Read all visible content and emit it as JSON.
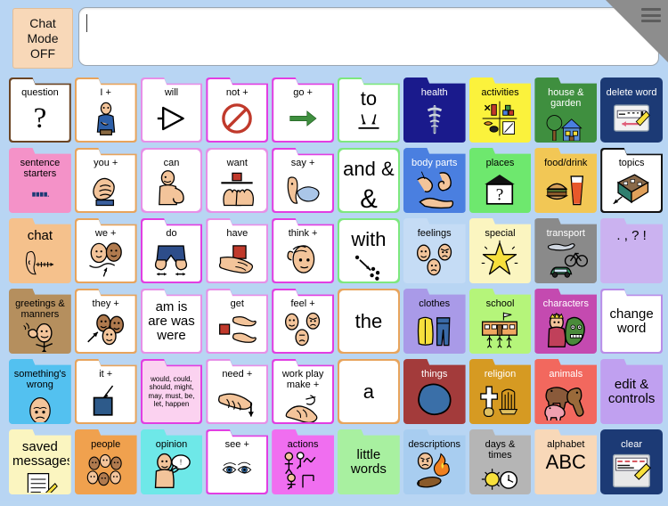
{
  "app": {
    "title": "AAC Communication Board",
    "background_color": "#b8d5f3"
  },
  "topbar": {
    "chat_mode_label": "Chat\nMode\nOFF",
    "chat_mode_line1": "Chat",
    "chat_mode_line2": "Mode",
    "chat_mode_line3": "OFF",
    "chat_mode_color": "#f8d8b8",
    "message_value": "",
    "message_placeholder": "",
    "menu_icon": "hamburger-menu-icon",
    "corner_color": "#8d8d8d"
  },
  "grid": {
    "columns": 10,
    "rows": 6,
    "buttons": [
      {
        "r": 1,
        "c": 1,
        "label": "question",
        "sub": "?",
        "bg": "#ffffff",
        "border": "#6b4423",
        "shape": "folder",
        "icon": "question-mark",
        "label_size": "small"
      },
      {
        "r": 1,
        "c": 2,
        "label": "I +",
        "bg": "#ffffff",
        "border": "#e8a45c",
        "shape": "folder",
        "icon": "person-pointing-self",
        "label_size": "small"
      },
      {
        "r": 1,
        "c": 3,
        "label": "will",
        "bg": "#ffffff",
        "border": "#e78fe7",
        "shape": "folder",
        "icon": "triangle-arrow-right",
        "label_size": "small"
      },
      {
        "r": 1,
        "c": 4,
        "label": "not +",
        "bg": "#ffffff",
        "border": "#e23ee2",
        "shape": "folder",
        "icon": "prohibition-sign",
        "label_size": "small"
      },
      {
        "r": 1,
        "c": 5,
        "label": "go +",
        "bg": "#ffffff",
        "border": "#e23ee2",
        "shape": "folder",
        "icon": "green-arrow-right",
        "label_size": "small"
      },
      {
        "r": 1,
        "c": 6,
        "label": "to",
        "bg": "#ffffff",
        "border": "#7ee87e",
        "shape": "folder",
        "icon": "two-arrows-down-line",
        "label_size": "big"
      },
      {
        "r": 1,
        "c": 7,
        "label": "health",
        "bg": "#1a1a8c",
        "border": "#1a1a8c",
        "shape": "folder",
        "icon": "caduceus",
        "label_color": "#ffffff",
        "label_size": "small"
      },
      {
        "r": 1,
        "c": 8,
        "label": "activities",
        "bg": "#fbf23c",
        "border": "#fbf23c",
        "shape": "folder",
        "icon": "craft-supplies",
        "label_size": "small"
      },
      {
        "r": 1,
        "c": 9,
        "label": "house & garden",
        "bg": "#3f8f3f",
        "border": "#3f8f3f",
        "shape": "folder",
        "icon": "house-and-tree",
        "label_color": "#ffffff",
        "label_size": "small"
      },
      {
        "r": 1,
        "c": 10,
        "label": "delete word",
        "bg": "#1c3a75",
        "border": "#1c3a75",
        "shape": "plain",
        "icon": "delete-word-eraser",
        "label_color": "#ffffff",
        "label_size": "small"
      },
      {
        "r": 2,
        "c": 1,
        "label": "sentence starters",
        "bg": "#f492c8",
        "border": "#f492c8",
        "shape": "folder",
        "icon": "sentence-blocks",
        "label_size": "small"
      },
      {
        "r": 2,
        "c": 2,
        "label": "you +",
        "bg": "#ffffff",
        "border": "#e8a45c",
        "shape": "folder",
        "icon": "pointing-hand",
        "label_size": "small"
      },
      {
        "r": 2,
        "c": 3,
        "label": "can",
        "bg": "#ffffff",
        "border": "#e78fe7",
        "shape": "plain",
        "icon": "flexing-arm",
        "label_size": "small"
      },
      {
        "r": 2,
        "c": 4,
        "label": "want",
        "bg": "#ffffff",
        "border": "#e78fe7",
        "shape": "plain",
        "icon": "hands-reaching-block",
        "label_size": "small"
      },
      {
        "r": 2,
        "c": 5,
        "label": "say +",
        "bg": "#ffffff",
        "border": "#e23ee2",
        "shape": "folder",
        "icon": "speech-bubble-face",
        "label_size": "small"
      },
      {
        "r": 2,
        "c": 6,
        "label": "and &",
        "bg": "#ffffff",
        "border": "#7ee87e",
        "shape": "plain",
        "icon": "ampersand",
        "label_size": "big"
      },
      {
        "r": 2,
        "c": 7,
        "label": "body parts",
        "bg": "#4a7fe0",
        "border": "#4a7fe0",
        "shape": "folder",
        "icon": "ear-arm-foot",
        "label_color": "#ffffff",
        "label_size": "small"
      },
      {
        "r": 2,
        "c": 8,
        "label": "places",
        "bg": "#6ee86e",
        "border": "#6ee86e",
        "shape": "folder",
        "icon": "building-question",
        "label_size": "small"
      },
      {
        "r": 2,
        "c": 9,
        "label": "food/drink",
        "bg": "#f2c755",
        "border": "#f2c755",
        "shape": "folder",
        "icon": "burger-and-drink",
        "label_size": "small"
      },
      {
        "r": 2,
        "c": 10,
        "label": "topics",
        "bg": "#ffffff",
        "border": "#111111",
        "shape": "folder",
        "icon": "topic-map",
        "label_size": "small"
      },
      {
        "r": 3,
        "c": 1,
        "label": "chat",
        "bg": "#f5c18c",
        "border": "#f5c18c",
        "shape": "folder",
        "icon": "talking-head",
        "label_size": "med"
      },
      {
        "r": 3,
        "c": 2,
        "label": "we +",
        "bg": "#ffffff",
        "border": "#e8a45c",
        "shape": "folder",
        "icon": "two-faces",
        "label_size": "small"
      },
      {
        "r": 3,
        "c": 3,
        "label": "do",
        "bg": "#ffffff",
        "border": "#e23ee2",
        "shape": "folder",
        "icon": "legs-walking",
        "label_size": "small"
      },
      {
        "r": 3,
        "c": 4,
        "label": "have",
        "bg": "#ffffff",
        "border": "#e78fe7",
        "shape": "folder",
        "icon": "hand-holding-block",
        "label_size": "small"
      },
      {
        "r": 3,
        "c": 5,
        "label": "think +",
        "bg": "#ffffff",
        "border": "#e23ee2",
        "shape": "folder",
        "icon": "thinking-head",
        "label_size": "small"
      },
      {
        "r": 3,
        "c": 6,
        "label": "with",
        "bg": "#ffffff",
        "border": "#7ee87e",
        "shape": "plain",
        "icon": "arrow-to-dots",
        "label_size": "big"
      },
      {
        "r": 3,
        "c": 7,
        "label": "feelings",
        "bg": "#c5dcf5",
        "border": "#c5dcf5",
        "shape": "folder",
        "icon": "three-faces-feelings",
        "label_size": "small"
      },
      {
        "r": 3,
        "c": 8,
        "label": "special",
        "bg": "#fbf5c0",
        "border": "#fbf5c0",
        "shape": "folder",
        "icon": "yellow-star",
        "label_size": "small"
      },
      {
        "r": 3,
        "c": 9,
        "label": "transport",
        "bg": "#8a8a8a",
        "border": "#8a8a8a",
        "shape": "folder",
        "icon": "plane-bike-car",
        "label_color": "#ffffff",
        "label_size": "small"
      },
      {
        "r": 3,
        "c": 10,
        "label": ". , ? !",
        "bg": "#cbb2f0",
        "border": "#cbb2f0",
        "shape": "folder",
        "icon": "punctuation",
        "label_size": "med"
      },
      {
        "r": 4,
        "c": 1,
        "label": "greetings & manners",
        "bg": "#b58f5e",
        "border": "#b58f5e",
        "shape": "folder",
        "icon": "waving-person",
        "label_size": "small"
      },
      {
        "r": 4,
        "c": 2,
        "label": "they +",
        "bg": "#ffffff",
        "border": "#e8a45c",
        "shape": "folder",
        "icon": "three-faces-arrow",
        "label_size": "small"
      },
      {
        "r": 4,
        "c": 3,
        "label": "am is are was were",
        "bg": "#ffffff",
        "border": "#e78fe7",
        "shape": "folder",
        "icon": "",
        "label_size": "med"
      },
      {
        "r": 4,
        "c": 4,
        "label": "get",
        "bg": "#ffffff",
        "border": "#e78fe7",
        "shape": "folder",
        "icon": "hands-taking-block",
        "label_size": "small"
      },
      {
        "r": 4,
        "c": 5,
        "label": "feel +",
        "bg": "#ffffff",
        "border": "#e23ee2",
        "shape": "folder",
        "icon": "faces-emotions",
        "label_size": "small"
      },
      {
        "r": 4,
        "c": 6,
        "label": "the",
        "bg": "#ffffff",
        "border": "#e8a45c",
        "shape": "plain",
        "icon": "",
        "label_size": "big"
      },
      {
        "r": 4,
        "c": 7,
        "label": "clothes",
        "bg": "#a99ae8",
        "border": "#a99ae8",
        "shape": "folder",
        "icon": "shirt-and-trousers",
        "label_size": "small"
      },
      {
        "r": 4,
        "c": 8,
        "label": "school",
        "bg": "#b5f57a",
        "border": "#b5f57a",
        "shape": "folder",
        "icon": "school-building",
        "label_size": "small"
      },
      {
        "r": 4,
        "c": 9,
        "label": "characters",
        "bg": "#c44ab0",
        "border": "#c44ab0",
        "shape": "folder",
        "icon": "princess-and-monster",
        "label_color": "#ffffff",
        "label_size": "small"
      },
      {
        "r": 4,
        "c": 10,
        "label": "change word",
        "bg": "#ffffff",
        "border": "#b98ce8",
        "shape": "folder",
        "icon": "",
        "label_size": "med"
      },
      {
        "r": 5,
        "c": 1,
        "label": "something's wrong",
        "bg": "#53c1f0",
        "border": "#53c1f0",
        "shape": "folder",
        "icon": "sad-face",
        "label_size": "small"
      },
      {
        "r": 5,
        "c": 2,
        "label": "it +",
        "bg": "#ffffff",
        "border": "#e8a45c",
        "shape": "folder",
        "icon": "blue-square-arrow",
        "label_size": "small"
      },
      {
        "r": 5,
        "c": 3,
        "label": "would, could, should, might, may, must, be, let, happen",
        "bg": "#fbd2f0",
        "border": "#e23ee2",
        "shape": "folder",
        "icon": "",
        "label_size": "tiny"
      },
      {
        "r": 5,
        "c": 4,
        "label": "need +",
        "bg": "#ffffff",
        "border": "#e78fe7",
        "shape": "folder",
        "icon": "hand-pointing-down",
        "label_size": "small"
      },
      {
        "r": 5,
        "c": 5,
        "label": "work play make +",
        "bg": "#ffffff",
        "border": "#e23ee2",
        "shape": "folder",
        "icon": "working-hands",
        "label_size": "small"
      },
      {
        "r": 5,
        "c": 6,
        "label": "a",
        "bg": "#ffffff",
        "border": "#e8a45c",
        "shape": "plain",
        "icon": "",
        "label_size": "big"
      },
      {
        "r": 5,
        "c": 7,
        "label": "things",
        "bg": "#a33b3b",
        "border": "#a33b3b",
        "shape": "folder",
        "icon": "blue-blob",
        "label_color": "#ffffff",
        "label_size": "small"
      },
      {
        "r": 5,
        "c": 8,
        "label": "religion",
        "bg": "#d69a22",
        "border": "#d69a22",
        "shape": "folder",
        "icon": "cross-and-menorah",
        "label_color": "#ffffff",
        "label_size": "small"
      },
      {
        "r": 5,
        "c": 9,
        "label": "animals",
        "bg": "#f2685e",
        "border": "#f2685e",
        "shape": "folder",
        "icon": "animals-group",
        "label_color": "#ffffff",
        "label_size": "small"
      },
      {
        "r": 5,
        "c": 10,
        "label": "edit & controls",
        "bg": "#c0a0f0",
        "border": "#c0a0f0",
        "shape": "folder",
        "icon": "",
        "label_size": "med"
      },
      {
        "r": 6,
        "c": 1,
        "label": "saved messages",
        "bg": "#fbf5c0",
        "border": "#fbf5c0",
        "shape": "folder",
        "icon": "note-paper",
        "label_size": "med"
      },
      {
        "r": 6,
        "c": 2,
        "label": "people",
        "bg": "#f0a14e",
        "border": "#f0a14e",
        "shape": "folder",
        "icon": "crowd-of-faces",
        "label_size": "small"
      },
      {
        "r": 6,
        "c": 3,
        "label": "opinion",
        "bg": "#6ee8e8",
        "border": "#6ee8e8",
        "shape": "folder",
        "icon": "person-speaking-opinion",
        "label_size": "small"
      },
      {
        "r": 6,
        "c": 4,
        "label": "see +",
        "bg": "#ffffff",
        "border": "#e23ee2",
        "shape": "folder",
        "icon": "two-eyes",
        "label_size": "small"
      },
      {
        "r": 6,
        "c": 5,
        "label": "actions",
        "bg": "#f06ef0",
        "border": "#f06ef0",
        "shape": "folder",
        "icon": "stick-figures-actions",
        "label_size": "small"
      },
      {
        "r": 6,
        "c": 6,
        "label": "little words",
        "bg": "#a8f0a0",
        "border": "#a8f0a0",
        "shape": "folder",
        "icon": "",
        "label_size": "med"
      },
      {
        "r": 6,
        "c": 7,
        "label": "descriptions",
        "bg": "#a8cdf0",
        "border": "#a8cdf0",
        "shape": "folder",
        "icon": "face-fire-log",
        "label_size": "small"
      },
      {
        "r": 6,
        "c": 8,
        "label": "days & times",
        "bg": "#b5b5b5",
        "border": "#b5b5b5",
        "shape": "folder",
        "icon": "sun-and-clock",
        "label_size": "small"
      },
      {
        "r": 6,
        "c": 9,
        "label": "alphabet",
        "sub": "ABC",
        "bg": "#f8d8b8",
        "border": "#f8d8b8",
        "shape": "folder",
        "icon": "abc-letters",
        "label_size": "small"
      },
      {
        "r": 6,
        "c": 10,
        "label": "clear",
        "bg": "#1c3a75",
        "border": "#1c3a75",
        "shape": "plain",
        "icon": "clear-screen-eraser",
        "label_color": "#ffffff",
        "label_size": "small"
      }
    ]
  }
}
